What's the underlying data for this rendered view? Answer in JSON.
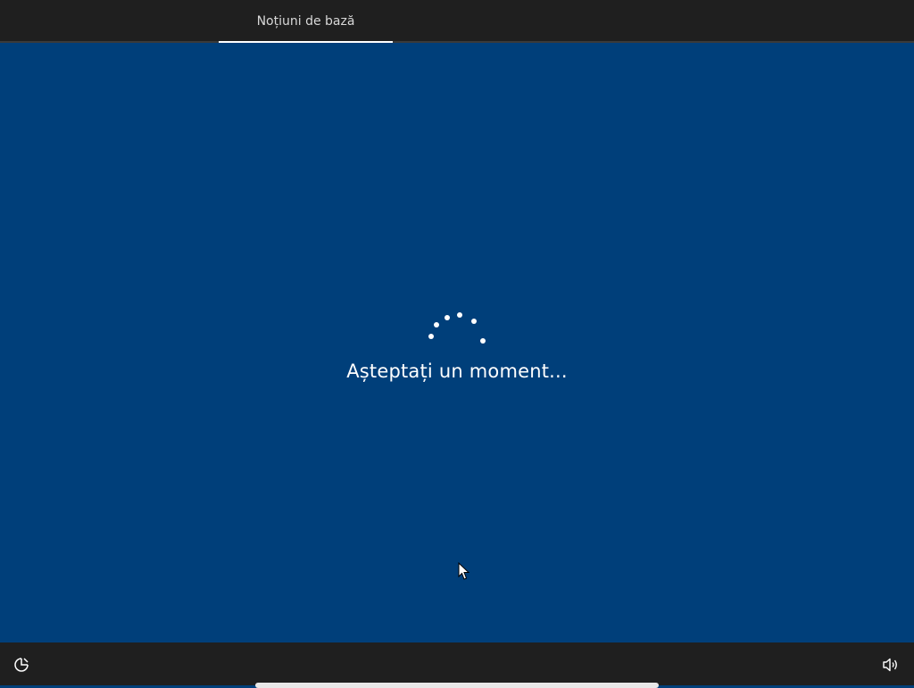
{
  "header": {
    "tab_label": "Noțiuni de bază"
  },
  "main": {
    "message": "Așteptați un moment..."
  },
  "icons": {
    "spinner": "loading-spinner-icon",
    "cursor": "mouse-pointer-icon",
    "ease_of_access": "ease-of-access-icon",
    "volume": "volume-icon"
  },
  "colors": {
    "background": "#003f7a",
    "bar": "#1f1f1f",
    "text": "#ffffff"
  }
}
